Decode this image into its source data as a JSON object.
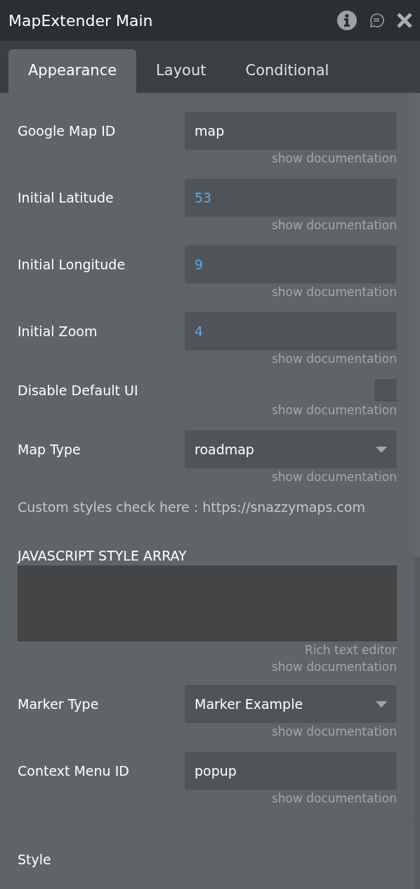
{
  "window": {
    "title": "MapExtender Main"
  },
  "tabs": [
    {
      "label": "Appearance",
      "selected": true
    },
    {
      "label": "Layout",
      "selected": false
    },
    {
      "label": "Conditional",
      "selected": false
    }
  ],
  "fields": [
    {
      "kind": "text",
      "label": "Google Map ID",
      "value": "map",
      "doc": "show documentation"
    },
    {
      "kind": "number",
      "label": "Initial Latitude",
      "value": "53",
      "doc": "show documentation"
    },
    {
      "kind": "number",
      "label": "Initial Longitude",
      "value": "9",
      "doc": "show documentation"
    },
    {
      "kind": "number",
      "label": "Initial Zoom",
      "value": "4",
      "doc": "show documentation"
    },
    {
      "kind": "checkbox",
      "label": "Disable Default UI",
      "checked": false,
      "doc": "show documentation"
    },
    {
      "kind": "dropdown",
      "label": "Map Type",
      "value": "roadmap",
      "doc": "show documentation"
    },
    {
      "kind": "note",
      "text": "Custom styles check here : https://snazzymaps.com"
    },
    {
      "kind": "textarea",
      "label": "JAVASCRIPT STYLE ARRAY",
      "hint": "Rich text editor",
      "doc": "show documentation"
    },
    {
      "kind": "dropdown",
      "label": "Marker Type",
      "value": "Marker Example",
      "doc": "show documentation"
    },
    {
      "kind": "text",
      "label": "Context Menu ID",
      "value": "popup",
      "doc": "show documentation"
    }
  ],
  "section": {
    "title": "Style"
  }
}
